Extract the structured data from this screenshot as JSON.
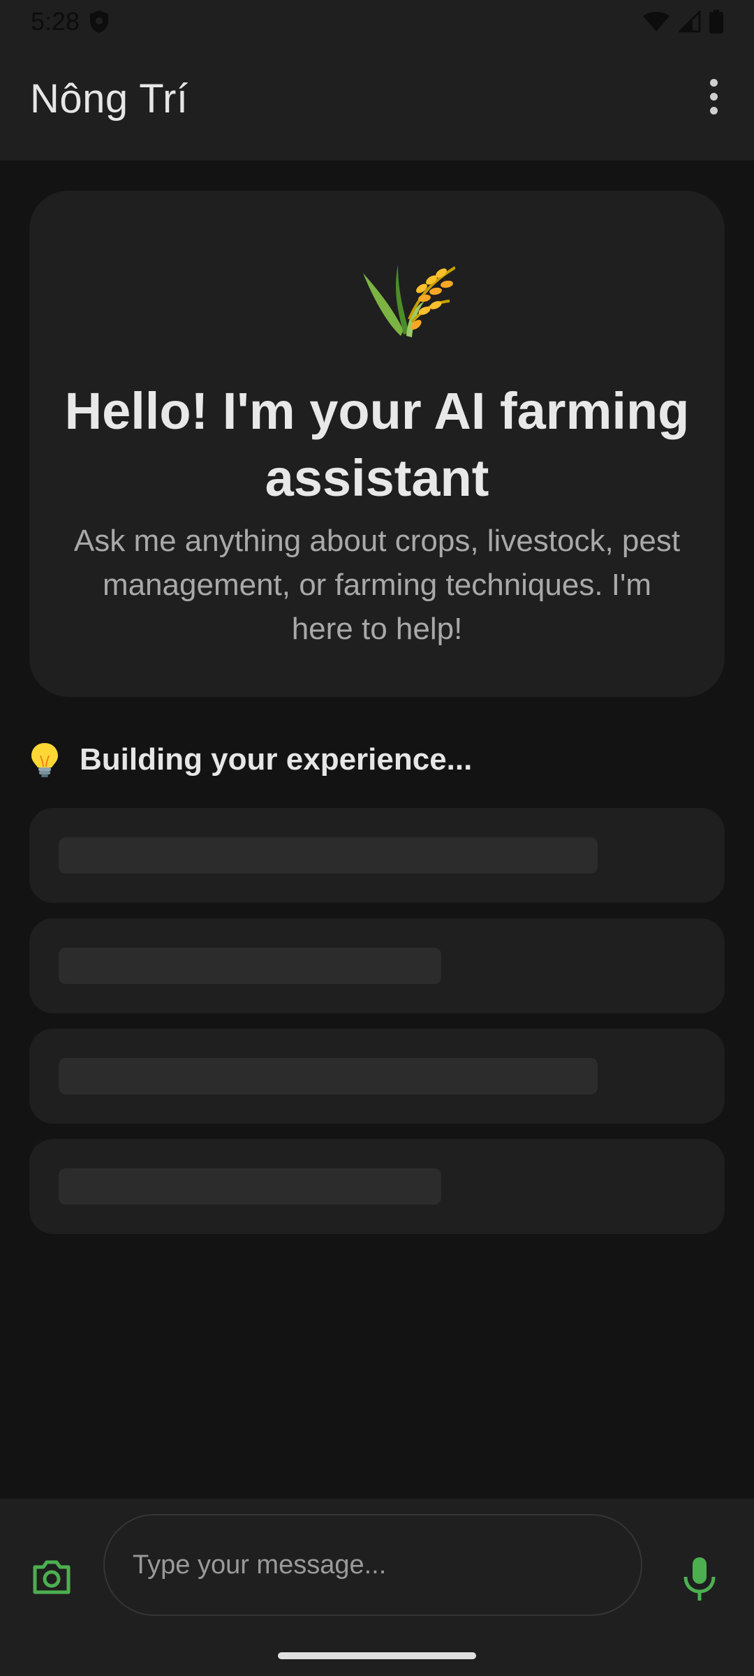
{
  "status_bar": {
    "time": "5:28",
    "icons": [
      "shield-icon",
      "wifi-icon",
      "signal-icon",
      "battery-icon"
    ]
  },
  "app_bar": {
    "title": "Nông Trí",
    "menu_icon": "more-vert-icon"
  },
  "welcome": {
    "icon": "rice-plant-icon",
    "title": "Hello! I'm your AI farming assistant",
    "subtitle": "Ask me anything about crops, livestock, pest management, or farming techniques. I'm here to help!"
  },
  "suggestions": {
    "icon": "lightbulb-icon",
    "header": "Building your experience...",
    "loading": true,
    "skeleton_count": 4
  },
  "composer": {
    "placeholder": "Type your message...",
    "value": "",
    "camera_icon": "camera-icon",
    "mic_icon": "microphone-icon"
  },
  "colors": {
    "background": "#131313",
    "surface": "#1f1f1f",
    "skeleton": "#2c2c2c",
    "accent": "#4caf50",
    "text_primary": "#e6e6e6",
    "text_secondary": "#a9a9a9"
  }
}
